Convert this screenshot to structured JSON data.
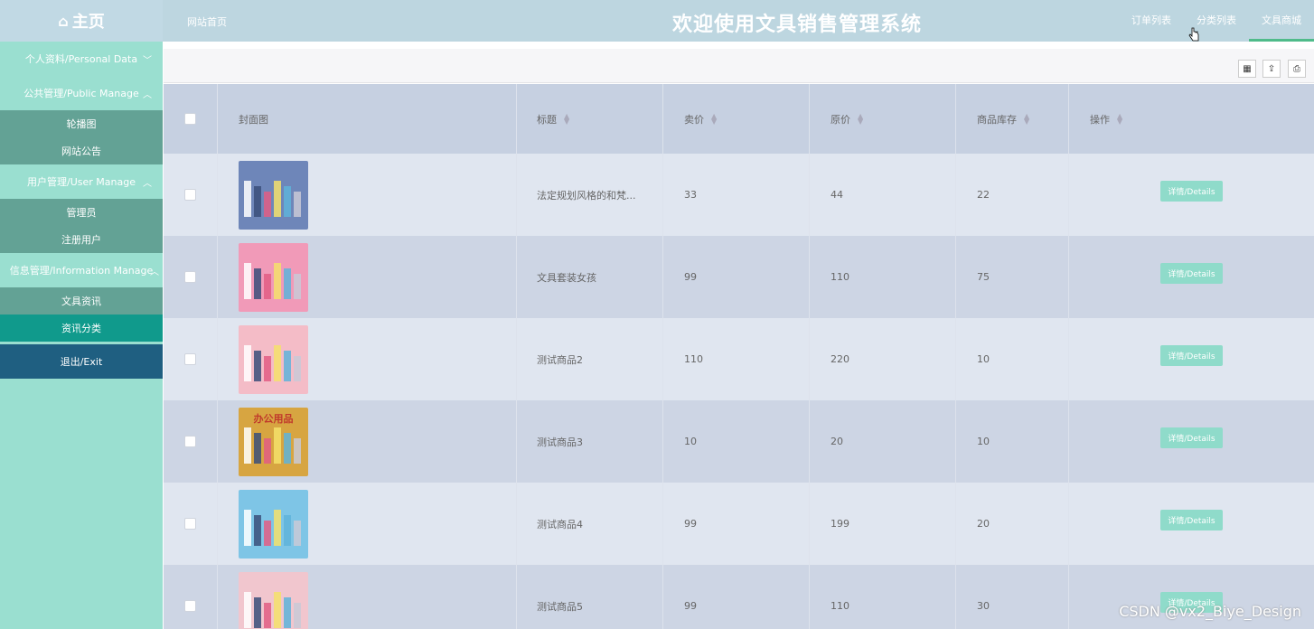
{
  "header": {
    "brand": "主页",
    "home_link": "网站首页",
    "title": "欢迎使用文具销售管理系统",
    "nav": [
      {
        "label": "订单列表"
      },
      {
        "label": "分类列表"
      },
      {
        "label": "文具商城"
      }
    ]
  },
  "sidebar": {
    "groups": [
      {
        "label": "个人资料/Personal Data",
        "chevron": "v",
        "items": []
      },
      {
        "label": "公共管理/Public Manage",
        "chevron": "^",
        "items": [
          "轮播图",
          "网站公告"
        ]
      },
      {
        "label": "用户管理/User Manage",
        "chevron": "^",
        "items": [
          "管理员",
          "注册用户"
        ]
      },
      {
        "label": "信息管理/Information Manage",
        "chevron": "^",
        "items": [
          "文具资讯",
          "资讯分类"
        ]
      }
    ],
    "exit": "退出/Exit"
  },
  "table": {
    "columns": [
      "封面图",
      "标题",
      "卖价",
      "原价",
      "商品库存",
      "操作"
    ],
    "detail_label": "详情/Details",
    "rows": [
      {
        "title": "法定规划风格的和梵...",
        "price": "33",
        "original": "44",
        "stock": "22",
        "thumb_color": "#6e86b9"
      },
      {
        "title": "文具套装女孩",
        "price": "99",
        "original": "110",
        "stock": "75",
        "thumb_color": "#f19ab8"
      },
      {
        "title": "测试商品2",
        "price": "110",
        "original": "220",
        "stock": "10",
        "thumb_color": "#f4bcc7"
      },
      {
        "title": "测试商品3",
        "price": "10",
        "original": "20",
        "stock": "10",
        "thumb_color": "#d7a541"
      },
      {
        "title": "测试商品4",
        "price": "99",
        "original": "199",
        "stock": "20",
        "thumb_color": "#7ec5e6"
      },
      {
        "title": "测试商品5",
        "price": "99",
        "original": "110",
        "stock": "30",
        "thumb_color": "#f1c6ce"
      }
    ]
  },
  "thumb_captions": [
    "办公用品"
  ],
  "watermark": "CSDN @vx2_Biye_Design"
}
